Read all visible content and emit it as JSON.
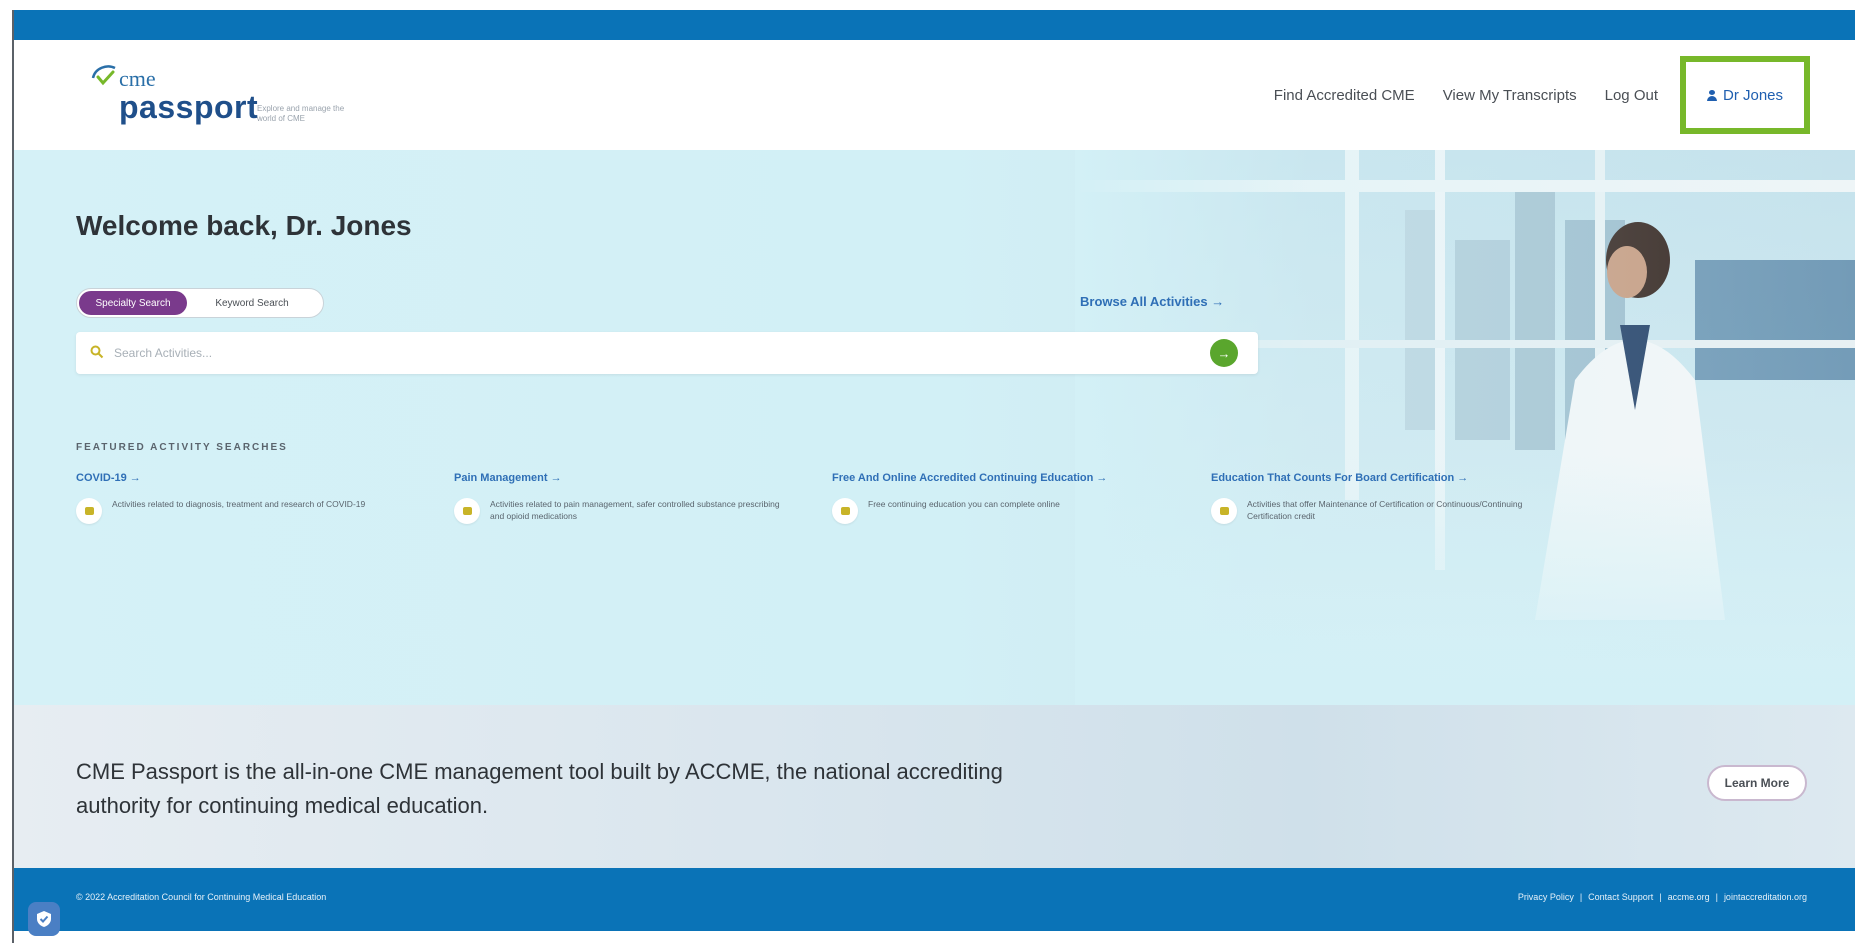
{
  "header": {
    "logo": {
      "brand_top": "cme",
      "brand_main": "passport",
      "tagline": "Explore and manage the world of CME"
    },
    "nav": {
      "find": "Find Accredited CME",
      "transcripts": "View My Transcripts",
      "logout": "Log Out",
      "user": "Dr Jones"
    }
  },
  "hero": {
    "welcome": "Welcome back, Dr. Jones",
    "toggle": {
      "specialty": "Specialty Search",
      "keyword": "Keyword Search"
    },
    "browse": "Browse All Activities →",
    "search": {
      "placeholder": "Search Activities..."
    },
    "featured_title": "FEATURED ACTIVITY SEARCHES",
    "featured": [
      {
        "title": "COVID-19 →",
        "desc": "Activities related to diagnosis, treatment and research of COVID-19"
      },
      {
        "title": "Pain Management →",
        "desc": "Activities related to pain management, safer controlled substance prescribing and opioid medications"
      },
      {
        "title": "Free And Online Accredited Continuing Education →",
        "desc": "Free continuing education you can complete online"
      },
      {
        "title": "Education That Counts For Board Certification →",
        "desc": "Activities that offer Maintenance of Certification or Continuous/Continuing Certification credit"
      }
    ]
  },
  "banner": {
    "text": "CME Passport is the all-in-one CME management tool built by ACCME, the national accrediting authority for continuing medical education.",
    "learn_more": "Learn More"
  },
  "footer": {
    "copyright": "© 2022 Accreditation Council for Continuing Medical Education",
    "links": [
      "Privacy Policy",
      "Contact Support",
      "accme.org",
      "jointaccreditation.org"
    ],
    "separator": "|"
  },
  "colors": {
    "brand_blue": "#0a73b7",
    "highlight_green": "#77b82a",
    "toggle_purple": "#7a3a8c",
    "go_green": "#5aa62d"
  }
}
